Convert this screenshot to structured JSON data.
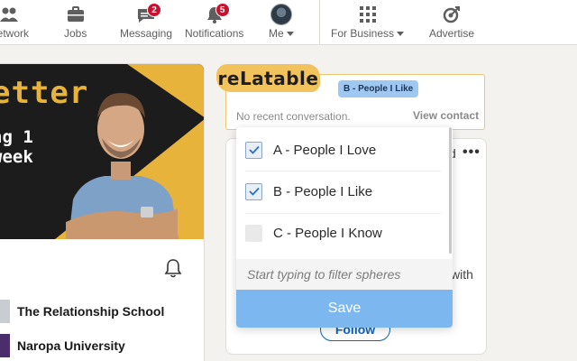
{
  "nav": {
    "items": [
      {
        "label": "Network",
        "icon": "network-icon"
      },
      {
        "label": "Jobs",
        "icon": "briefcase-icon"
      },
      {
        "label": "Messaging",
        "icon": "messaging-icon",
        "badge": "2"
      },
      {
        "label": "Notifications",
        "icon": "bell-icon",
        "badge": "5"
      },
      {
        "label": "Me",
        "icon": "avatar"
      },
      {
        "label": "For Business",
        "icon": "grid-icon"
      },
      {
        "label": "Advertise",
        "icon": "advertise-icon"
      }
    ]
  },
  "profile_banner": {
    "line1": "etter",
    "line2": "ng 1",
    "line3": "week"
  },
  "organizations": [
    {
      "name": "The Relationship School"
    },
    {
      "name": "Naropa University"
    }
  ],
  "relatable": {
    "logo": "reLatable",
    "chip": "B - People I Like",
    "no_recent": "No recent conversation.",
    "view_contact": "View contact"
  },
  "dropdown": {
    "options": [
      {
        "label": "A - People I Love",
        "checked": true
      },
      {
        "label": "B - People I Like",
        "checked": true
      },
      {
        "label": "C - People I Know",
        "checked": false
      }
    ],
    "filter_placeholder": "Start typing to filter spheres",
    "save_label": "Save"
  },
  "background_card": {
    "partial_d": "d",
    "partial_with": "with",
    "follow_label": "Follow"
  },
  "colors": {
    "accent_yellow": "#f2c25c",
    "chip_blue": "#9ec7f2",
    "save_blue": "#7db7ef",
    "badge_red": "#cb112d",
    "linkedin_blue": "#0a66c2"
  }
}
